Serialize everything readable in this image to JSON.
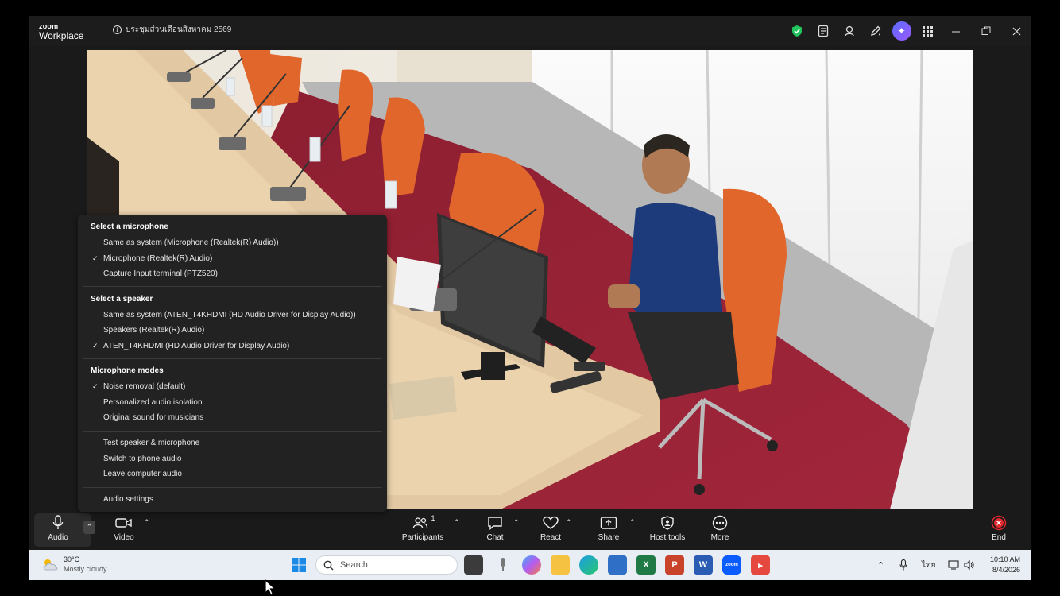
{
  "app": {
    "logo_line1": "zoom",
    "logo_line2": "Workplace",
    "meeting_title": "ประชุมส่วนเดือนสิงหาคม 2569"
  },
  "colors": {
    "shield": "#21c45d",
    "end_red": "#e0282e",
    "accent": "#5b6cff"
  },
  "audio_menu": {
    "sections": {
      "microphone_head": "Select a microphone",
      "mic_items": [
        "Same as system (Microphone (Realtek(R) Audio))",
        "Microphone (Realtek(R) Audio)",
        "Capture Input terminal (PTZ520)"
      ],
      "speaker_head": "Select a speaker",
      "speaker_items": [
        "Same as system (ATEN_T4KHDMI (HD Audio Driver for Display Audio))",
        "Speakers (Realtek(R) Audio)",
        "ATEN_T4KHDMI (HD Audio Driver for Display Audio)"
      ],
      "modes_head": "Microphone modes",
      "mode_items": [
        "Noise removal (default)",
        "Personalized audio isolation",
        "Original sound for musicians"
      ],
      "action_items": [
        "Test speaker & microphone",
        "Switch to phone audio",
        "Leave computer audio"
      ],
      "settings_item": "Audio settings"
    },
    "checkmark": "✓"
  },
  "toolbar": {
    "audio": "Audio",
    "video": "Video",
    "participants": "Participants",
    "participants_count": "1",
    "chat": "Chat",
    "react": "React",
    "share": "Share",
    "host_tools": "Host tools",
    "more": "More",
    "end": "End"
  },
  "taskbar": {
    "temp": "30°C",
    "weather": "Mostly cloudy",
    "search_placeholder": "Search",
    "lang": "ไทย",
    "time": "10:10 AM",
    "date": "8/4/2026"
  }
}
